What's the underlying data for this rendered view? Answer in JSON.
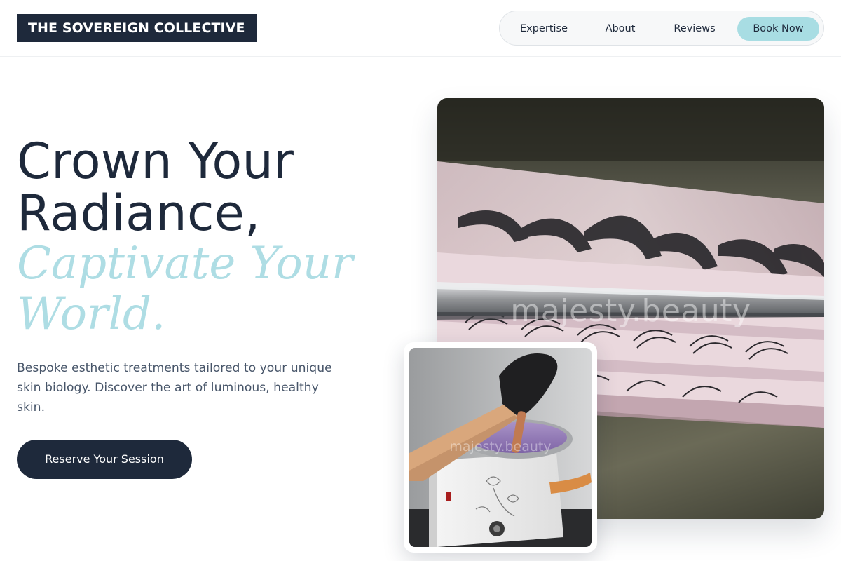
{
  "brand": {
    "name": "THE SOVEREIGN COLLECTIVE"
  },
  "nav": {
    "items": [
      {
        "label": "Expertise"
      },
      {
        "label": "About"
      },
      {
        "label": "Reviews"
      },
      {
        "label": "Book Now"
      }
    ]
  },
  "hero": {
    "headline_line1": "Crown Your",
    "headline_line2": "Radiance,",
    "accent_line1": "Captivate Your",
    "accent_line2": "World.",
    "lede": "Bespoke esthetic treatments tailored to your unique skin biology. Discover the art of luminous, healthy skin.",
    "cta_label": "Reserve Your Session"
  },
  "images": {
    "main_watermark": "majesty.beauty",
    "inset_watermark": "majesty.beauty"
  },
  "colors": {
    "navy": "#1e293b",
    "accent_teal": "#aedde4",
    "book_pill": "#a8dde3",
    "body_text": "#475569"
  }
}
